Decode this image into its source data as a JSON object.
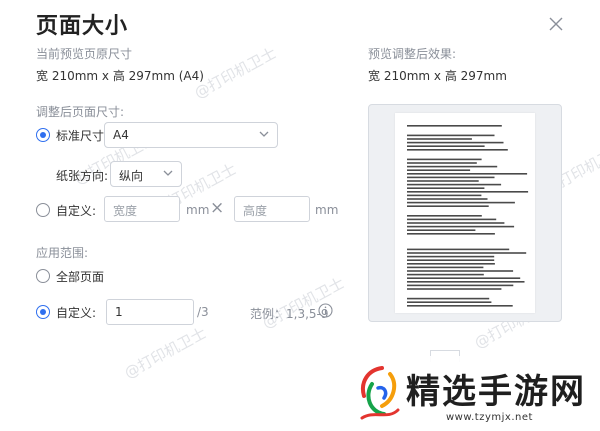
{
  "dialog": {
    "title": "页面大小"
  },
  "current": {
    "label": "当前预览页原尺寸",
    "size": "宽 210mm x 高 297mm (A4)"
  },
  "adjusted_preview": {
    "label": "预览调整后效果:",
    "size": "宽 210mm x 高 297mm"
  },
  "adjust": {
    "label": "调整后页面尺寸:",
    "standard_label": "标准尺寸:",
    "standard_value": "A4",
    "orientation_label": "纸张方向:",
    "orientation_value": "纵向",
    "custom_label": "自定义:",
    "width_placeholder": "宽度",
    "height_placeholder": "高度",
    "unit": "mm",
    "times": "×"
  },
  "scope": {
    "label": "应用范围:",
    "all_pages_label": "全部页面",
    "custom_label": "自定义:",
    "custom_value": "1",
    "total_pages": "/3",
    "example": "范例：1,3,5-9"
  },
  "watermark_text": "@打印机卫士",
  "brand": {
    "title": "精选手游网",
    "url": "www.tzymjx.net"
  },
  "colors": {
    "accent": "#2f6fef",
    "border": "#cfd3da",
    "muted": "#8a8f99"
  }
}
